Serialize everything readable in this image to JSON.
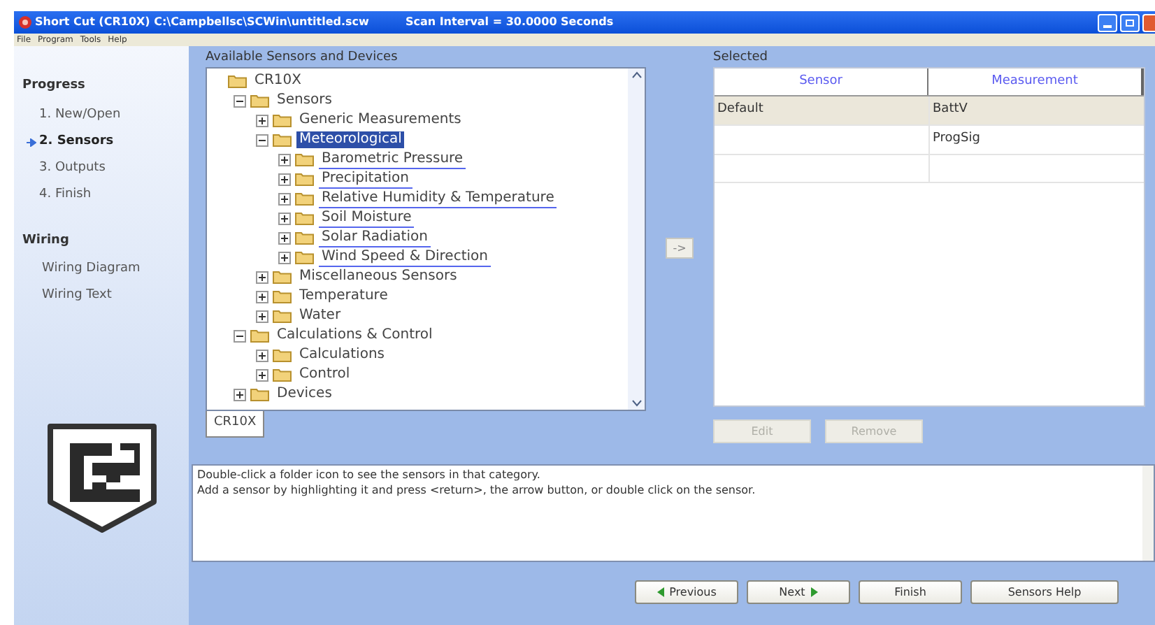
{
  "window": {
    "title": "Short Cut (CR10X) C:\\Campbellsc\\SCWin\\untitled.scw",
    "scan_interval": "Scan Interval = 30.0000 Seconds"
  },
  "menu": [
    "File",
    "Program",
    "Tools",
    "Help"
  ],
  "progress": {
    "heading": "Progress",
    "steps": [
      {
        "label": "1. New/Open",
        "selected": false
      },
      {
        "label": "2. Sensors",
        "selected": true
      },
      {
        "label": "3. Outputs",
        "selected": false
      },
      {
        "label": "4. Finish",
        "selected": false
      }
    ]
  },
  "wiring": {
    "heading": "Wiring",
    "items": [
      "Wiring Diagram",
      "Wiring Text"
    ]
  },
  "available": {
    "heading": "Available Sensors and Devices",
    "tab": "CR10X",
    "tree": [
      {
        "label": "CR10X",
        "selected": false,
        "underlined": false,
        "children": [
          {
            "label": "Sensors",
            "expanded": true,
            "selected": false,
            "underlined": false,
            "children": [
              {
                "label": "Generic Measurements",
                "expanded": false,
                "selected": false,
                "underlined": false
              },
              {
                "label": "Meteorological",
                "expanded": true,
                "selected": true,
                "underlined": false,
                "children": [
                  {
                    "label": "Barometric Pressure",
                    "expanded": false,
                    "selected": false,
                    "underlined": true
                  },
                  {
                    "label": "Precipitation",
                    "expanded": false,
                    "selected": false,
                    "underlined": true
                  },
                  {
                    "label": "Relative Humidity & Temperature",
                    "expanded": false,
                    "selected": false,
                    "underlined": true
                  },
                  {
                    "label": "Soil Moisture",
                    "expanded": false,
                    "selected": false,
                    "underlined": true
                  },
                  {
                    "label": "Solar Radiation",
                    "expanded": false,
                    "selected": false,
                    "underlined": true
                  },
                  {
                    "label": "Wind Speed & Direction",
                    "expanded": false,
                    "selected": false,
                    "underlined": true
                  }
                ]
              },
              {
                "label": "Miscellaneous Sensors",
                "expanded": false,
                "selected": false,
                "underlined": false
              },
              {
                "label": "Temperature",
                "expanded": false,
                "selected": false,
                "underlined": false
              },
              {
                "label": "Water",
                "expanded": false,
                "selected": false,
                "underlined": false
              }
            ]
          },
          {
            "label": "Calculations & Control",
            "expanded": true,
            "selected": false,
            "underlined": false,
            "children": [
              {
                "label": "Calculations",
                "expanded": false,
                "selected": false,
                "underlined": false
              },
              {
                "label": "Control",
                "expanded": false,
                "selected": false,
                "underlined": false
              }
            ]
          },
          {
            "label": "Devices",
            "expanded": false,
            "selected": false,
            "underlined": false
          }
        ]
      }
    ]
  },
  "arrow_button": "->",
  "selected": {
    "heading": "Selected",
    "columns": [
      "Sensor",
      "Measurement"
    ],
    "rows": [
      {
        "sensor": "Default",
        "measurement": "BattV",
        "selected": true
      },
      {
        "measurement": "ProgSig",
        "selected": false
      }
    ],
    "buttons": [
      {
        "label": "Edit",
        "disabled": true
      },
      {
        "label": "Remove",
        "disabled": true
      }
    ]
  },
  "help_text": [
    "Double-click a folder icon to see the sensors in that category.",
    "Add a sensor by highlighting it and press <return>, the arrow button, or double click on the sensor."
  ],
  "nav_buttons": [
    {
      "label": "Previous",
      "kind": "back"
    },
    {
      "label": "Next",
      "kind": "forward"
    },
    {
      "label": "Finish",
      "kind": "plain"
    },
    {
      "label": "Sensors Help",
      "kind": "plain"
    }
  ]
}
